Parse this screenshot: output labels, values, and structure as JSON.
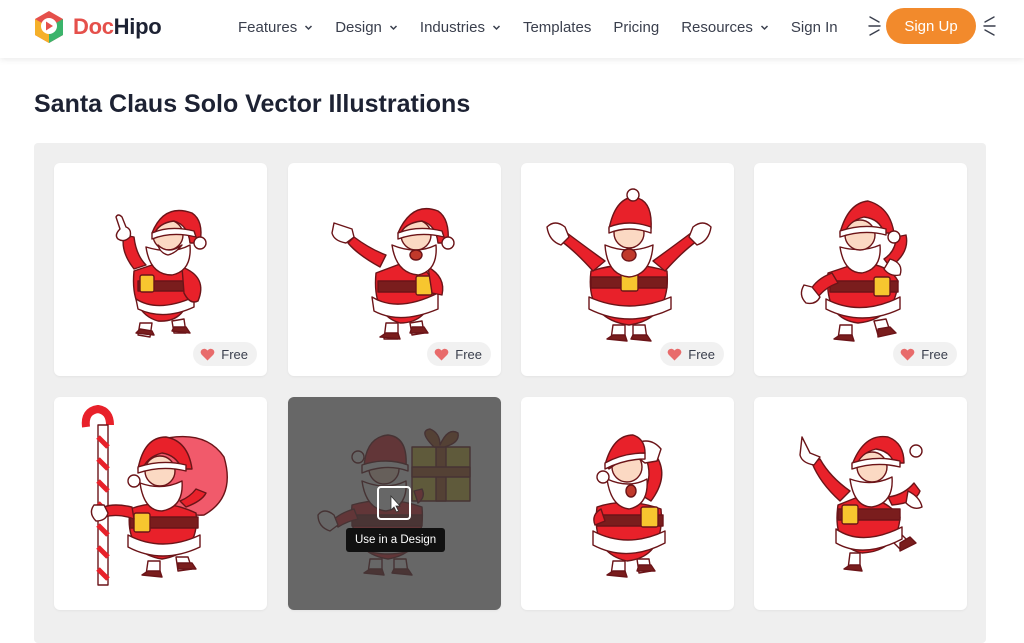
{
  "brand": {
    "name_part1": "Doc",
    "name_part2": "Hipo"
  },
  "nav": {
    "features": "Features",
    "design": "Design",
    "industries": "Industries",
    "templates": "Templates",
    "pricing": "Pricing",
    "resources": "Resources",
    "sign_in": "Sign In",
    "sign_up": "Sign Up"
  },
  "page": {
    "title": "Santa Claus Solo Vector Illustrations"
  },
  "cards": [
    {
      "pose": "santa-pointing-up",
      "badge": "Free"
    },
    {
      "pose": "santa-pointing-side",
      "badge": "Free"
    },
    {
      "pose": "santa-arms-open",
      "badge": "Free"
    },
    {
      "pose": "santa-waving",
      "badge": "Free"
    },
    {
      "pose": "santa-candy-cane-sack"
    },
    {
      "pose": "santa-with-gift",
      "hover_label": "Use in a Design"
    },
    {
      "pose": "santa-looking-far"
    },
    {
      "pose": "santa-running-pointing"
    }
  ],
  "colors": {
    "accent": "#f28a2c",
    "title": "#1d2233",
    "heart": "#e86b6b",
    "santa_red": "#e8212a"
  }
}
